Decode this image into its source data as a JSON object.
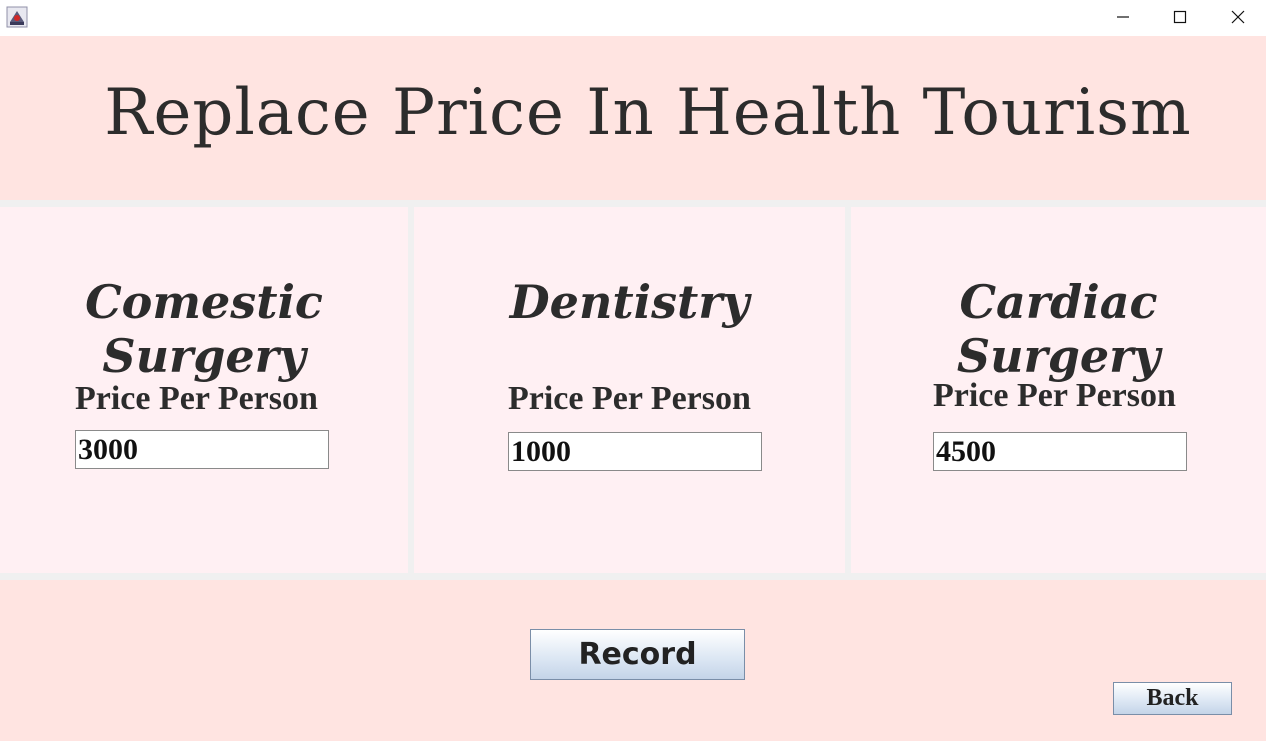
{
  "window": {
    "icon": "java-cup-icon",
    "controls": [
      "minimize-icon",
      "maximize-icon",
      "close-icon"
    ]
  },
  "header": {
    "title": "Replace Price In Health Tourism"
  },
  "panels": [
    {
      "title": "Comestic Surgery",
      "price_label": "Price Per Person",
      "price_value": "3000"
    },
    {
      "title": "Dentistry",
      "price_label": "Price Per Person",
      "price_value": "1000"
    },
    {
      "title": "Cardiac Surgery",
      "price_label": "Price Per Person",
      "price_value": "4500"
    }
  ],
  "footer": {
    "record_label": "Record",
    "back_label": "Back"
  },
  "colors": {
    "header_bg": "#ffe4e1",
    "panel_bg": "#fff0f3",
    "text": "#2c2c2c"
  }
}
